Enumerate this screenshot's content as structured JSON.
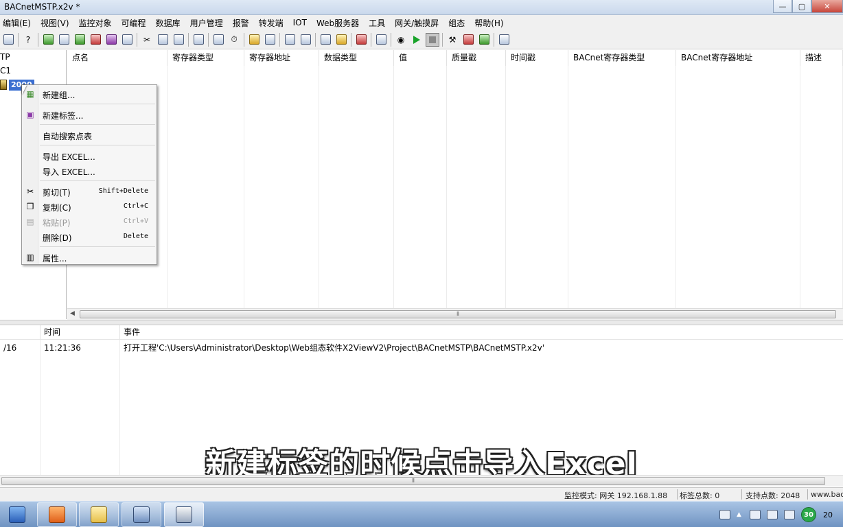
{
  "window": {
    "title": "BACnetMSTP.x2v *",
    "controls": [
      "—",
      "▢",
      "✕"
    ]
  },
  "menu": {
    "items": [
      "编辑(E)",
      "视图(V)",
      "监控对象",
      "可编程",
      "数据库",
      "用户管理",
      "报警",
      "转发端",
      "IOT",
      "Web服务器",
      "工具",
      "网关/触摸屏",
      "组态",
      "帮助(H)"
    ]
  },
  "tree": {
    "nodes": [
      "TP",
      "C1"
    ],
    "selected": "2000"
  },
  "grid": {
    "columns": [
      "点名",
      "寄存器类型",
      "寄存器地址",
      "数据类型",
      "值",
      "质量戳",
      "时间戳",
      "BACnet寄存器类型",
      "BACnet寄存器地址",
      "描述"
    ]
  },
  "context_menu": {
    "items": [
      {
        "label": "新建组...",
        "shortcut": ""
      },
      {
        "label": "新建标签...",
        "shortcut": ""
      },
      {
        "label": "自动搜索点表",
        "shortcut": ""
      },
      {
        "label": "导出 EXCEL...",
        "shortcut": ""
      },
      {
        "label": "导入 EXCEL...",
        "shortcut": ""
      },
      {
        "label": "剪切(T)",
        "shortcut": "Shift+Delete"
      },
      {
        "label": "复制(C)",
        "shortcut": "Ctrl+C"
      },
      {
        "label": "粘贴(P)",
        "shortcut": "Ctrl+V"
      },
      {
        "label": "删除(D)",
        "shortcut": "Delete"
      },
      {
        "label": "属性...",
        "shortcut": ""
      }
    ]
  },
  "log": {
    "columns": [
      "",
      "时间",
      "事件"
    ],
    "rows": [
      {
        "date": "/16",
        "time": "11:21:36",
        "event": "打开工程'C:\\Users\\Administrator\\Desktop\\Web组态软件X2ViewV2\\Project\\BACnetMSTP\\BACnetMSTP.x2v'"
      }
    ]
  },
  "subtitle": "新建标签的时候点击导入Excel",
  "status": {
    "mode": "监控模式: 网关 192.168.1.88",
    "tag_count": "标签总数: 0",
    "support": "支持点数: 2048",
    "site": "www.bacn"
  },
  "taskbar": {
    "tray_badge": "30",
    "clock": "20"
  },
  "colors": {
    "selection": "#3b6fd1",
    "taskbar": "#7fa0cc",
    "play": "#19a32a"
  }
}
